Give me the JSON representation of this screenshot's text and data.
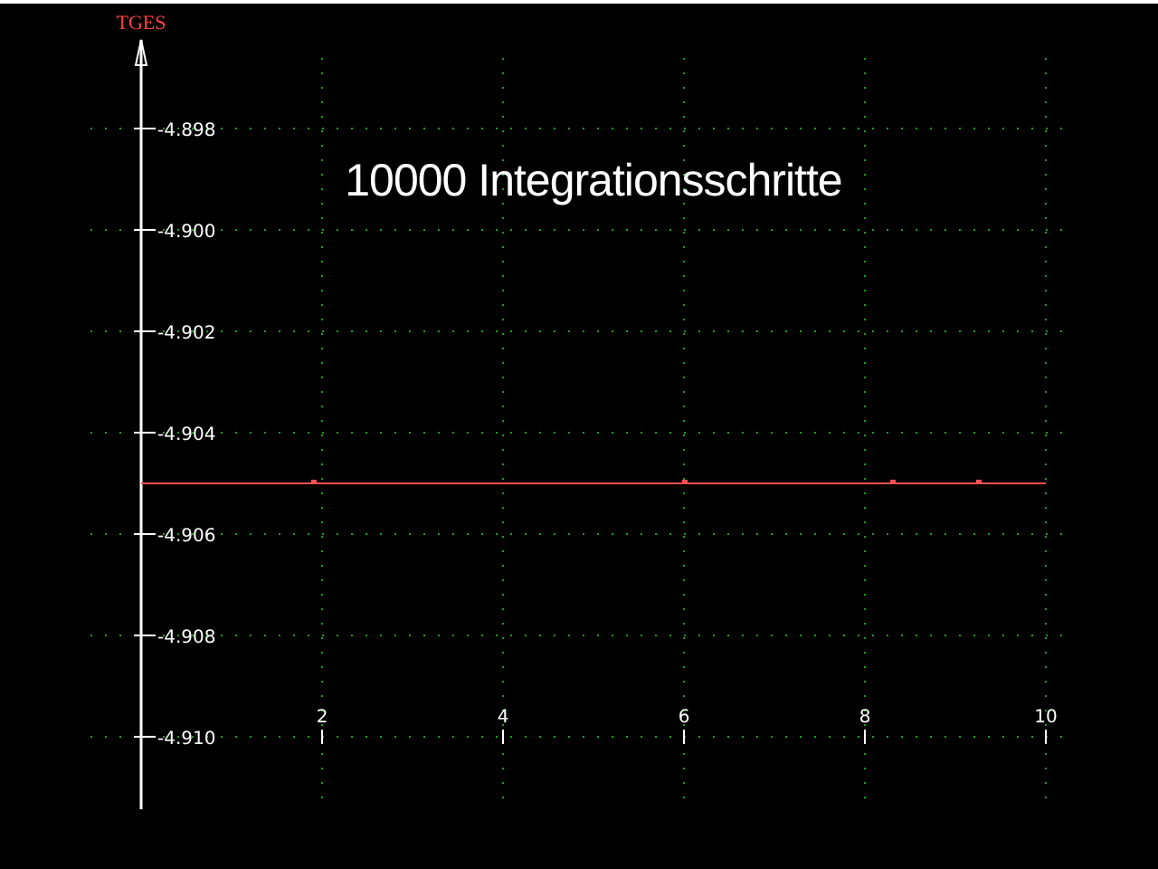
{
  "plot": {
    "chart_data": {
      "type": "line",
      "title": "10000 Integrationsschritte",
      "ylabel": "TGES",
      "x": [
        0,
        1.9,
        6,
        8.3,
        9.25,
        10
      ],
      "grid": true,
      "series": [
        {
          "color": "#ff5050",
          "values": [
            -4.905,
            -4.905,
            -4.905,
            -4.905,
            -4.905,
            -4.905
          ]
        }
      ],
      "xlim": [
        0,
        10
      ],
      "ylim": [
        -4.91143,
        -4.89625
      ],
      "xticks": [
        2,
        4,
        6,
        8,
        10
      ],
      "yticks": [
        {
          "value": -4.898,
          "label": "-4.898"
        },
        {
          "value": -4.9,
          "label": "-4.900"
        },
        {
          "value": -4.902,
          "label": "-4.902"
        },
        {
          "value": -4.904,
          "label": "-4.904"
        },
        {
          "value": -4.906,
          "label": "-4.906"
        },
        {
          "value": -4.908,
          "label": "-4.908"
        },
        {
          "value": -4.91,
          "label": "-4.910"
        }
      ]
    }
  }
}
